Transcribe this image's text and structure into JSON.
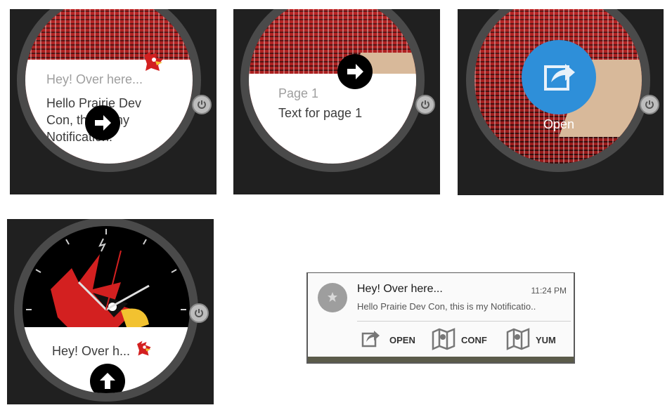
{
  "screen1": {
    "header": "Hey! Over here...",
    "body_lines": [
      "Hello Prairie Dev",
      "Con, this is my",
      "Notification!"
    ]
  },
  "screen2": {
    "page_title": "Page 1",
    "page_text": "Text for page 1"
  },
  "screen3": {
    "action_label": "Open"
  },
  "screen4": {
    "peek_text": "Hey! Over h..."
  },
  "notification": {
    "title": "Hey! Over here...",
    "time": "11:24 PM",
    "text": "Hello Prairie Dev Con, this is my Notificatio..",
    "actions": [
      {
        "label": "OPEN",
        "icon": "open-icon"
      },
      {
        "label": "CONF",
        "icon": "map-icon"
      },
      {
        "label": "YUM",
        "icon": "map-icon"
      }
    ]
  },
  "colors": {
    "accent_blue": "#2e8fd9",
    "cardinal_red": "#d32020"
  }
}
